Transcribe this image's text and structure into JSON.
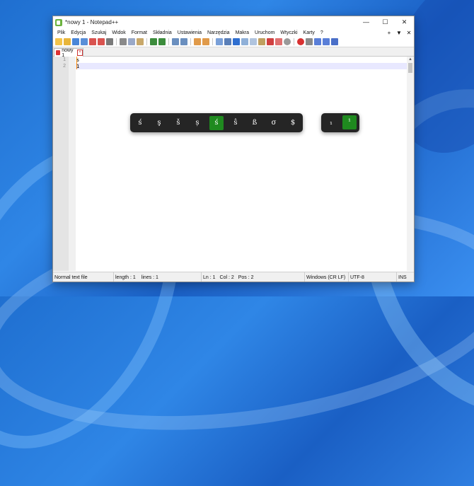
{
  "window": {
    "title": "*nowy 1 - Notepad++",
    "min": "—",
    "max": "☐",
    "close": "✕"
  },
  "menu": [
    "Plik",
    "Edycja",
    "Szukaj",
    "Widok",
    "Format",
    "Składnia",
    "Ustawienia",
    "Narzędzia",
    "Makra",
    "Uruchom",
    "Wtyczki",
    "Karty",
    "?"
  ],
  "menu_right": [
    "+",
    "▼",
    "✕"
  ],
  "tab": {
    "label": "nowy 1"
  },
  "editor": {
    "line_numbers": [
      "1",
      "2"
    ],
    "lines": [
      "s",
      "1"
    ]
  },
  "status": {
    "file_type": "Normal text file",
    "length": "length : 1",
    "lines": "lines : 1",
    "ln": "Ln : 1",
    "col": "Col : 2",
    "pos": "Pos : 2",
    "eol": "Windows (CR LF)",
    "encoding": "UTF-8",
    "ins": "INS"
  },
  "accent_popup": {
    "chars": [
      "ś",
      "ş",
      "š",
      "ș",
      "ś",
      "ŝ",
      "ß",
      "σ",
      "$"
    ],
    "selected_index": 4
  },
  "index_popup": {
    "chars": [
      "₁",
      "¹"
    ],
    "selected_index": 1
  },
  "colors": {
    "selection": "#1f8a1f",
    "popup_bg": "#252525",
    "caret": "#ff8c00"
  }
}
